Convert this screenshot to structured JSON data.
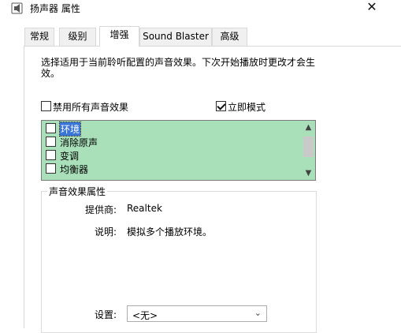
{
  "window": {
    "title": "扬声器 属性",
    "close_glyph": "✕"
  },
  "tabs": [
    {
      "label": "常规",
      "active": false
    },
    {
      "label": "级别",
      "active": false
    },
    {
      "label": "增强",
      "active": true
    },
    {
      "label": "Sound Blaster",
      "active": false
    },
    {
      "label": "高级",
      "active": false
    }
  ],
  "enhance": {
    "description": "选择适用于当前聆听配置的声音效果。下次开始播放时更改才会生效。",
    "disable_all": {
      "label": "禁用所有声音效果",
      "checked": false
    },
    "immediate_mode": {
      "label": "立即模式",
      "checked": true
    },
    "effects": [
      {
        "label": "环境",
        "checked": false,
        "selected": true
      },
      {
        "label": "消除原声",
        "checked": false,
        "selected": false
      },
      {
        "label": "变调",
        "checked": false,
        "selected": false
      },
      {
        "label": "均衡器",
        "checked": false,
        "selected": false
      }
    ],
    "effects_list_bg": "#a9e0ba",
    "properties": {
      "group_title": "声音效果属性",
      "provider_label": "提供商:",
      "provider_value": "Realtek",
      "description_label": "说明:",
      "description_value": "模拟多个播放环境。",
      "settings_label": "设置:",
      "settings_value": "<无>"
    }
  }
}
